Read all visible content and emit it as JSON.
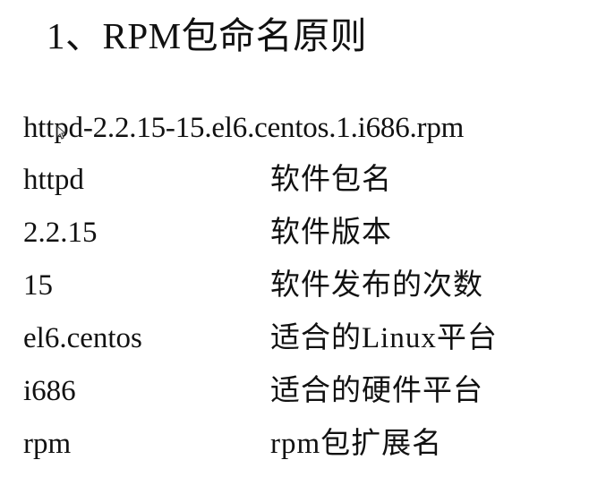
{
  "title": "1、RPM包命名原则",
  "package_name": "httpd-2.2.15-15.el6.centos.1.i686.rpm",
  "rows": [
    {
      "term": "httpd",
      "desc": "软件包名"
    },
    {
      "term": "2.2.15",
      "desc": "软件版本"
    },
    {
      "term": "15",
      "desc": "软件发布的次数"
    },
    {
      "term": "el6.centos",
      "desc": "适合的Linux平台"
    },
    {
      "term": "i686",
      "desc": "适合的硬件平台"
    },
    {
      "term": "rpm",
      "desc": "rpm包扩展名"
    }
  ],
  "icons": {
    "cursor": "mouse-cursor-icon"
  }
}
